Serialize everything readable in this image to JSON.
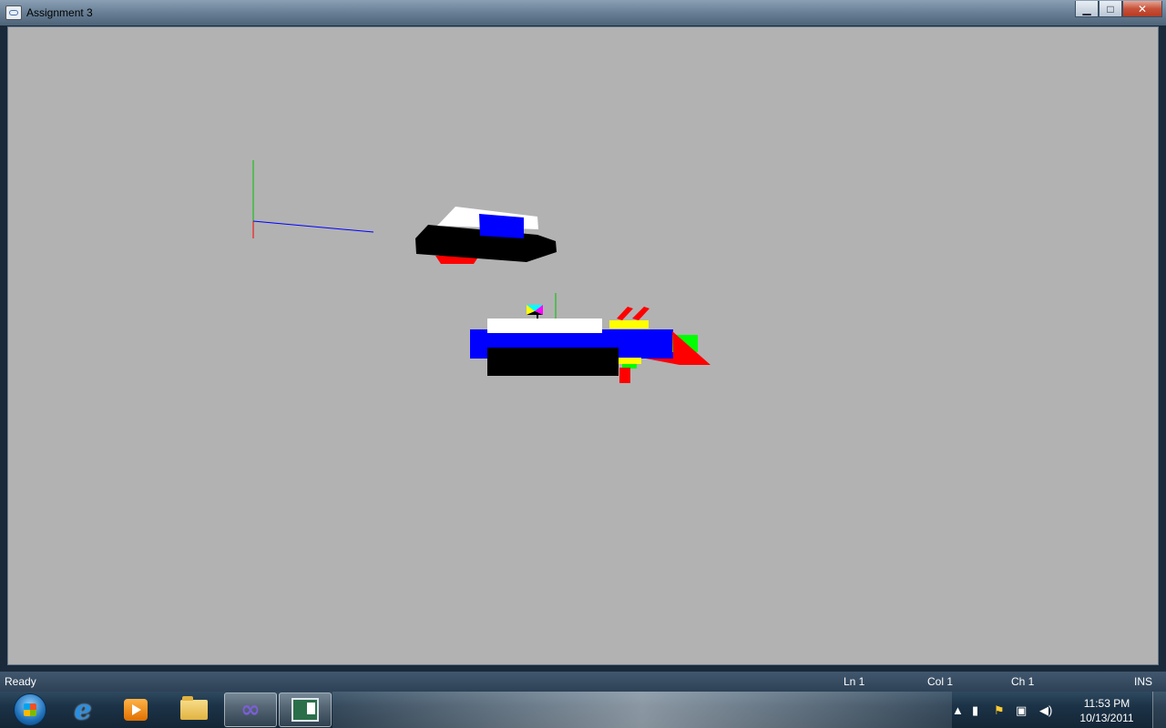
{
  "window": {
    "title": "Assignment 3",
    "buttons": {
      "minimize": "▁",
      "maximize": "□",
      "close": "✕"
    }
  },
  "scene": {
    "background": "#b2b2b2",
    "colors": {
      "axis_x": "#0000ff",
      "axis_y": "#00c000",
      "axis_z": "#ff0000",
      "hull_dark": "#000000",
      "deck_white": "#ffffff",
      "hull_blue": "#0000ff",
      "accent_red": "#ff0000",
      "accent_yellow": "#ffff00",
      "accent_green": "#00ff00",
      "flag_cyan": "#00ffff",
      "flag_magenta": "#ff00ff"
    }
  },
  "statusbar": {
    "status": "Ready",
    "line": "Ln 1",
    "column": "Col 1",
    "character": "Ch 1",
    "mode": "INS"
  },
  "taskbar": {
    "start_icon": "windows-start-orb",
    "pinned": [
      {
        "name": "internet-explorer-icon"
      },
      {
        "name": "media-player-icon"
      },
      {
        "name": "file-explorer-icon"
      },
      {
        "name": "visual-studio-icon"
      },
      {
        "name": "assignment-app-icon"
      }
    ],
    "clock": {
      "time": "11:53 PM",
      "date": "10/13/2011"
    }
  }
}
